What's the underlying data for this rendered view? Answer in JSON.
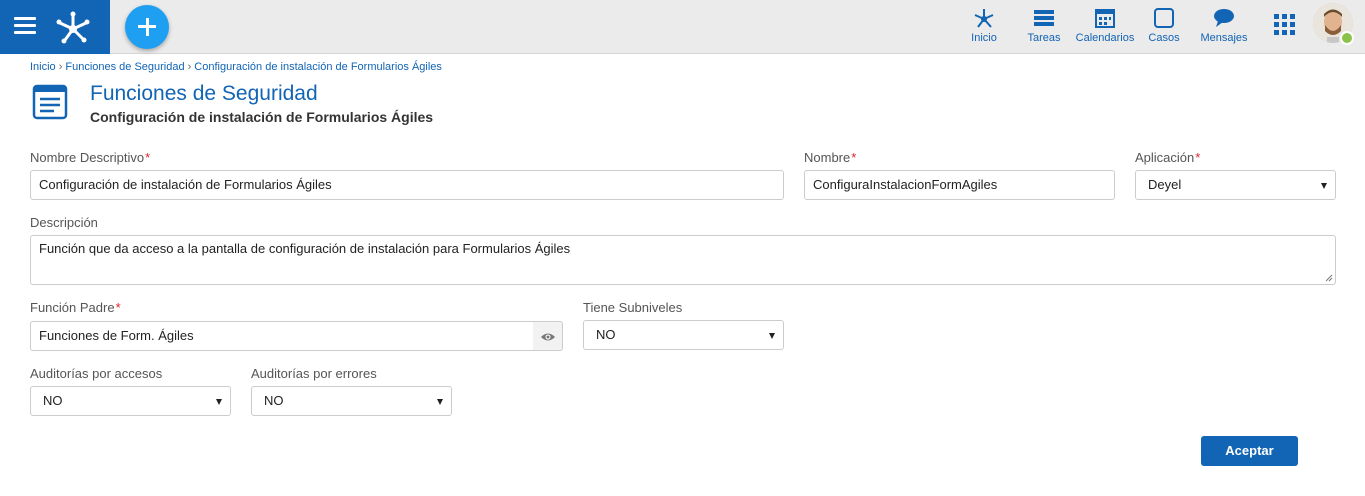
{
  "colors": {
    "brand": "#1264b4",
    "accent": "#1e9ff2",
    "required": "#d9232d",
    "status_online": "#8bc34a"
  },
  "topbar": {
    "menu_icon": "hamburger-icon",
    "logo_icon": "deyel-logo-icon",
    "add_icon": "plus-icon",
    "nav": [
      {
        "label": "Inicio",
        "icon": "network-icon"
      },
      {
        "label": "Tareas",
        "icon": "tasks-icon"
      },
      {
        "label": "Calendarios",
        "icon": "calendar-icon"
      },
      {
        "label": "Casos",
        "icon": "square-icon"
      },
      {
        "label": "Mensajes",
        "icon": "chat-bubble-icon"
      }
    ],
    "apps_icon": "grid-icon"
  },
  "breadcrumb": {
    "items": [
      "Inicio",
      "Funciones de Seguridad",
      "Configuración de instalación de Formularios Ágiles"
    ],
    "separator": "›"
  },
  "header": {
    "icon": "form-list-icon",
    "title": "Funciones de Seguridad",
    "subtitle": "Configuración de instalación de Formularios Ágiles"
  },
  "form": {
    "required_mark": "*",
    "nombre_descriptivo": {
      "label": "Nombre Descriptivo",
      "value": "Configuración de instalación de Formularios Ágiles"
    },
    "nombre": {
      "label": "Nombre",
      "value": "ConfiguraInstalacionFormAgiles"
    },
    "aplicacion": {
      "label": "Aplicación",
      "value": "Deyel"
    },
    "descripcion": {
      "label": "Descripción",
      "value": "Función que da acceso a la pantalla de configuración de instalación para Formularios Ágiles"
    },
    "funcion_padre": {
      "label": "Función Padre",
      "value": "Funciones de Form. Ágiles",
      "addon_icon": "eye-icon"
    },
    "tiene_subniveles": {
      "label": "Tiene Subniveles",
      "value": "NO"
    },
    "auditorias_accesos": {
      "label": "Auditorías por accesos",
      "value": "NO"
    },
    "auditorias_errores": {
      "label": "Auditorías por errores",
      "value": "NO"
    }
  },
  "actions": {
    "accept_label": "Aceptar"
  }
}
